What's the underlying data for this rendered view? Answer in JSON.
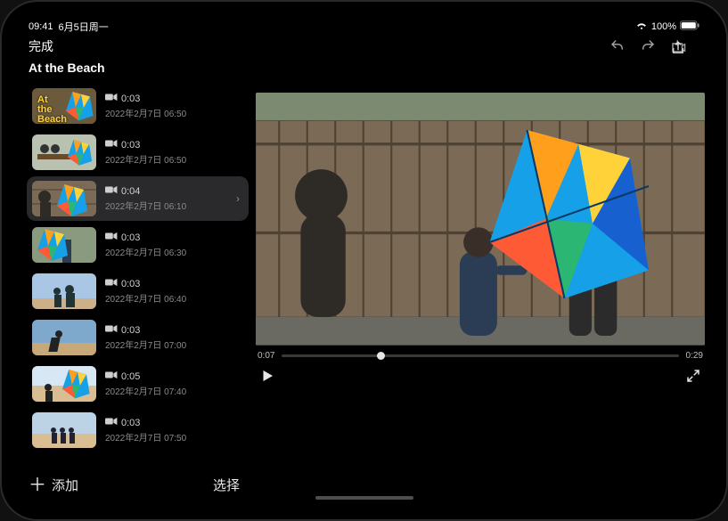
{
  "status": {
    "time": "09:41",
    "date": "6月5日周一",
    "battery": "100%"
  },
  "topbar": {
    "done": "完成"
  },
  "project": {
    "title": "At the Beach"
  },
  "clips": [
    {
      "title_overlay": "At the Beach",
      "duration": "0:03",
      "timestamp": "2022年2月7日 06:50",
      "thumb": "title",
      "selected": false
    },
    {
      "duration": "0:03",
      "timestamp": "2022年2月7日 06:50",
      "thumb": "bench",
      "selected": false
    },
    {
      "duration": "0:04",
      "timestamp": "2022年2月7日 06:10",
      "thumb": "fence",
      "selected": true
    },
    {
      "duration": "0:03",
      "timestamp": "2022年2月7日 06:30",
      "thumb": "spin",
      "selected": false
    },
    {
      "duration": "0:03",
      "timestamp": "2022年2月7日 06:40",
      "thumb": "walk",
      "selected": false
    },
    {
      "duration": "0:03",
      "timestamp": "2022年2月7日 07:00",
      "thumb": "run",
      "selected": false
    },
    {
      "duration": "0:05",
      "timestamp": "2022年2月7日 07:40",
      "thumb": "beach",
      "selected": false
    },
    {
      "duration": "0:03",
      "timestamp": "2022年2月7日 07:50",
      "thumb": "group",
      "selected": false
    }
  ],
  "sidebar_footer": {
    "add": "添加",
    "select": "选择"
  },
  "player": {
    "current": "0:07",
    "total": "0:29",
    "progress": 0.24
  }
}
